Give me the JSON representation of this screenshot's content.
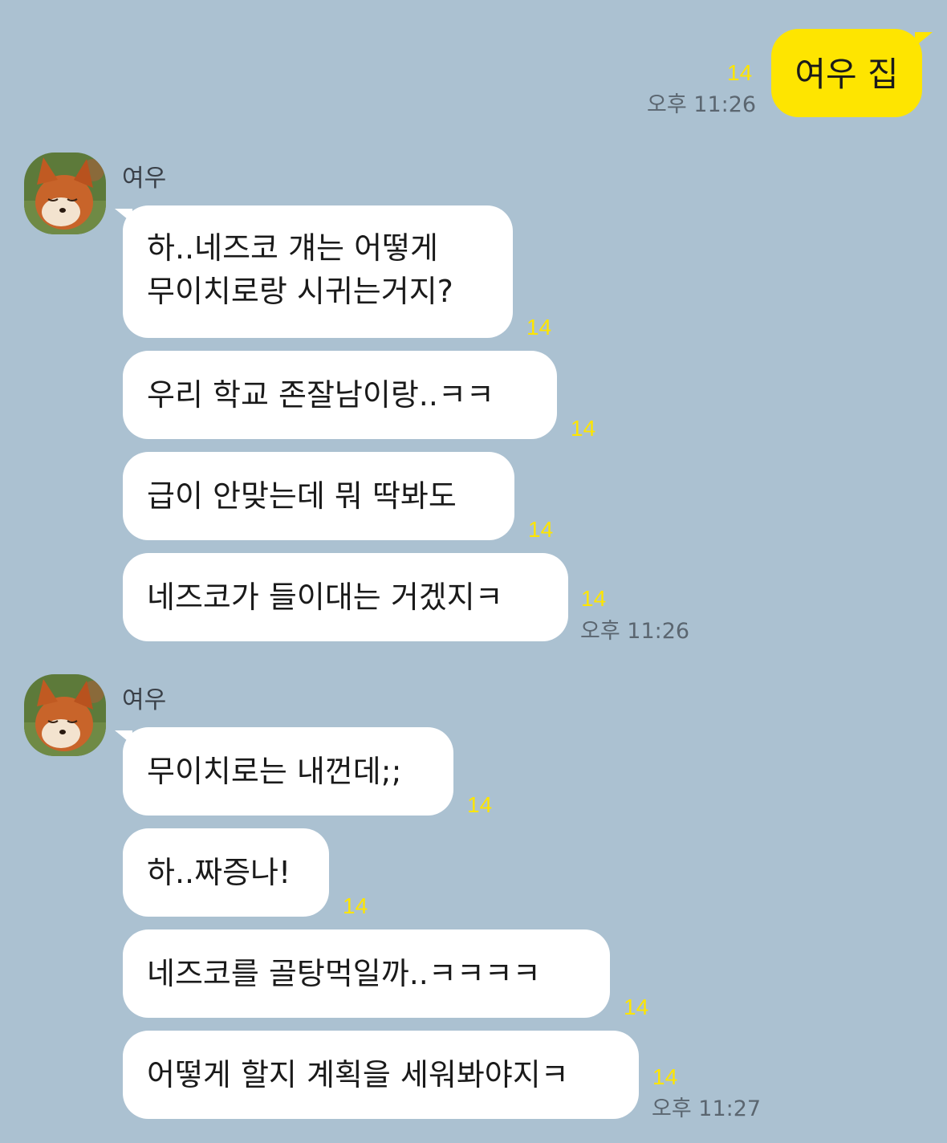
{
  "colors": {
    "background": "#abc1d1",
    "my_bubble": "#fee500",
    "their_bubble": "#ffffff",
    "unread_count": "#fee500"
  },
  "outgoing": {
    "text": "여우 집",
    "unread": "14",
    "time": "오후 11:26"
  },
  "group1": {
    "sender": "여우",
    "avatar_icon": "fox-avatar",
    "messages": [
      {
        "line1": "하..네즈코 걔는 어떻게",
        "line2": "무이치로랑 시귀는거지?",
        "unread": "14"
      },
      {
        "text": "우리 학교 존잘남이랑..ㅋㅋ",
        "unread": "14"
      },
      {
        "text": "급이 안맞는데 뭐 딱봐도",
        "unread": "14"
      },
      {
        "text": "네즈코가 들이대는 거겠지ㅋ",
        "unread": "14"
      }
    ],
    "time": "오후 11:26"
  },
  "group2": {
    "sender": "여우",
    "avatar_icon": "fox-avatar",
    "messages": [
      {
        "text": "무이치로는 내껀데;;",
        "unread": "14"
      },
      {
        "text": "하..짜증나!",
        "unread": "14"
      },
      {
        "text": "네즈코를 골탕먹일까..ㅋㅋㅋㅋ",
        "unread": "14"
      },
      {
        "text": "어떻게 할지 계획을 세워봐야지ㅋ",
        "unread": "14"
      }
    ],
    "time": "오후 11:27"
  }
}
